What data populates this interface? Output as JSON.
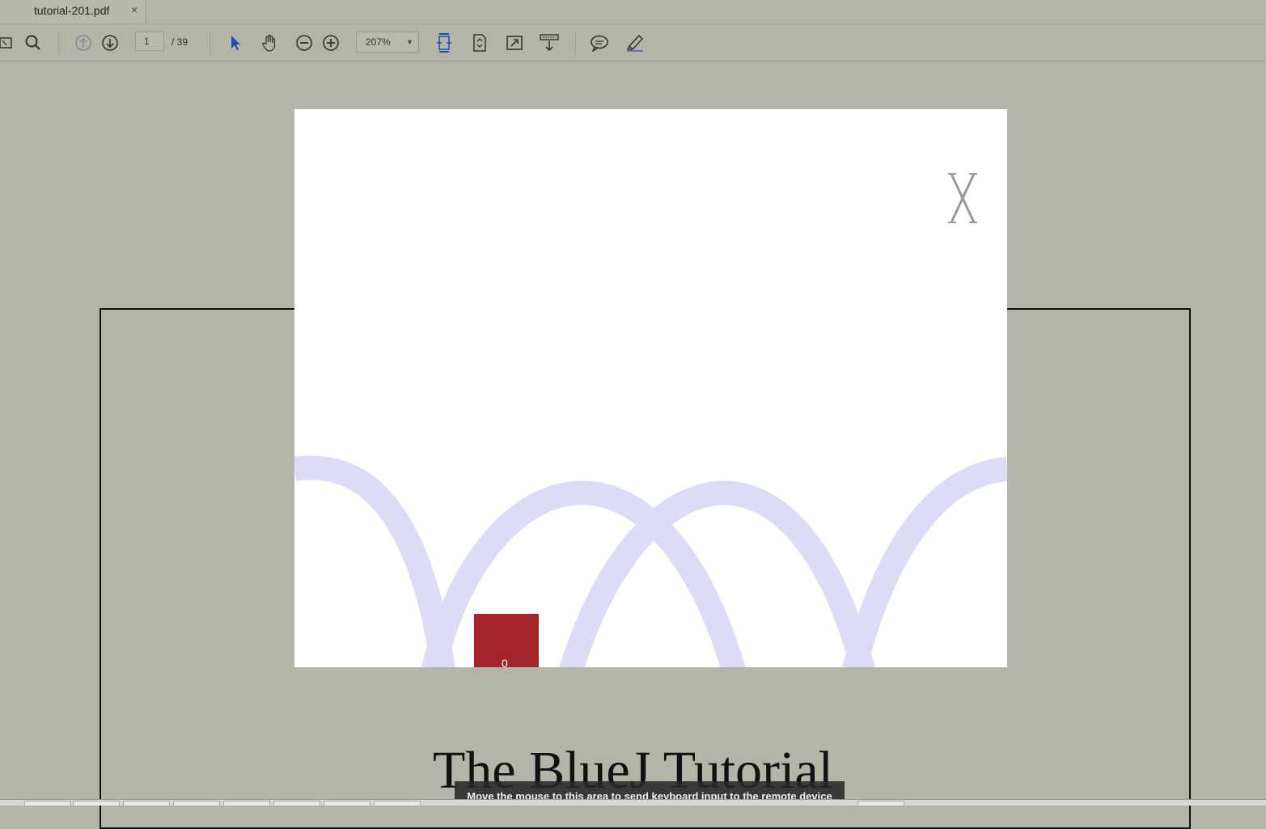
{
  "tab": {
    "title": "tutorial-201.pdf",
    "close_glyph": "×"
  },
  "toolbar": {
    "icons": [
      "sidebar-toggle-icon",
      "search-icon",
      "previous-page-icon",
      "next-page-icon",
      "select-arrow-icon",
      "hand-tool-icon",
      "zoom-out-icon",
      "zoom-in-icon",
      "fit-width-icon",
      "fit-page-icon",
      "fullscreen-icon",
      "scroll-mode-icon",
      "comment-icon",
      "highlight-icon"
    ],
    "page_current": "1",
    "page_total": "/ 39",
    "zoom": "207%"
  },
  "document": {
    "title": "The BlueJ Tutorial",
    "slide_mark": "X",
    "slide_label": "0"
  },
  "remote_hint": "Move the mouse to this area to send keyboard input to the remote device",
  "colors": {
    "background": "#b4b5a8",
    "arc": "#dcdcf6",
    "red_block": "#a3242b"
  }
}
